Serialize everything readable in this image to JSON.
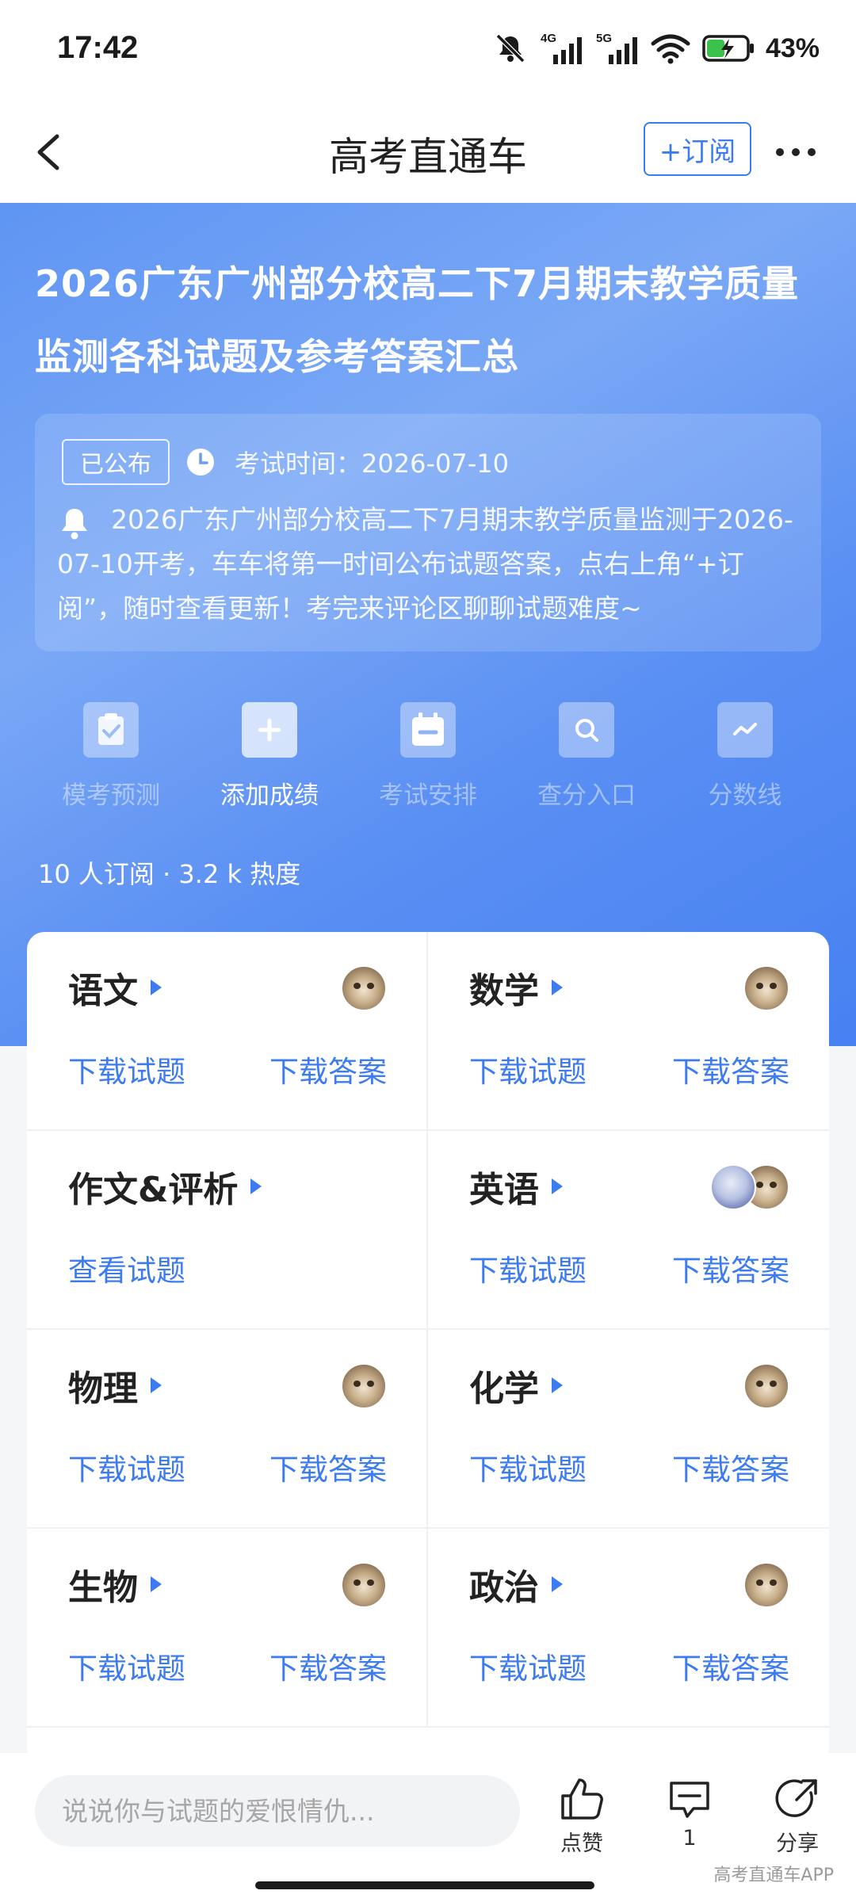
{
  "status_bar": {
    "time": "17:42",
    "signal_4g": "4G",
    "signal_5g": "5G",
    "battery": "43%"
  },
  "nav": {
    "title": "高考直通车",
    "subscribe_label": "+订阅"
  },
  "hero": {
    "title": "2026广东广州部分校高二下7月期末教学质量监测各科试题及参考答案汇总",
    "status_tag": "已公布",
    "exam_time": "考试时间：2026-07-10",
    "notice": "2026广东广州部分校高二下7月期末教学质量监测于2026-07-10开考，车车将第一时间公布试题答案，点右上角“+订阅”，随时查看更新！考完来评论区聊聊试题难度~",
    "quick_actions": [
      {
        "label": "模考预测",
        "icon": "clipboard-check-icon",
        "active": false
      },
      {
        "label": "添加成绩",
        "icon": "plus-icon",
        "active": true
      },
      {
        "label": "考试安排",
        "icon": "calendar-icon",
        "active": false
      },
      {
        "label": "查分入口",
        "icon": "search-icon",
        "active": false
      },
      {
        "label": "分数线",
        "icon": "trend-line-icon",
        "active": false
      }
    ],
    "stats": "10 人订阅 · 3.2 k 热度"
  },
  "subjects": [
    {
      "name": "语文",
      "actions": [
        "下载试题",
        "下载答案"
      ]
    },
    {
      "name": "数学",
      "actions": [
        "下载试题",
        "下载答案"
      ]
    },
    {
      "name": "作文&评析",
      "actions": [
        "查看试题"
      ]
    },
    {
      "name": "英语",
      "actions": [
        "下载试题",
        "下载答案"
      ]
    },
    {
      "name": "物理",
      "actions": [
        "下载试题",
        "下载答案"
      ]
    },
    {
      "name": "化学",
      "actions": [
        "下载试题",
        "下载答案"
      ]
    },
    {
      "name": "生物",
      "actions": [
        "下载试题",
        "下载答案"
      ]
    },
    {
      "name": "政治",
      "actions": [
        "下载试题",
        "下载答案"
      ]
    }
  ],
  "bottom_bar": {
    "comment_placeholder": "说说你与试题的爱恨情仇...",
    "like_label": "点赞",
    "comment_count": "1",
    "share_label": "分享",
    "watermark": "高考直通车APP"
  },
  "colors": {
    "accent": "#3d7bf0",
    "hero_gradient_start": "#5f95f3",
    "hero_gradient_end": "#4781f2"
  }
}
